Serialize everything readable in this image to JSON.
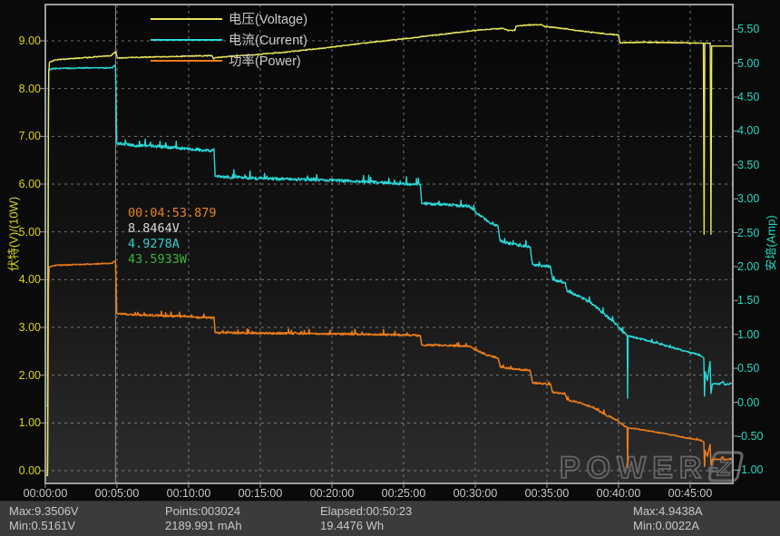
{
  "legend": [
    {
      "label": "电压(Voltage)",
      "color": "#e9e559"
    },
    {
      "label": "电流(Current)",
      "color": "#29d9d9"
    },
    {
      "label": "功率(Power)",
      "color": "#ea7c1c"
    }
  ],
  "axes": {
    "left": {
      "title": "伏特(V)/(10W)",
      "color": "#d6d41c",
      "ticks": [
        "9.00",
        "8.00",
        "7.00",
        "6.00",
        "5.00",
        "4.00",
        "3.00",
        "2.00",
        "1.00",
        "0.00"
      ]
    },
    "right": {
      "title": "安培(Amp)",
      "color": "#23d8c4",
      "ticks": [
        "5.50",
        "5.00",
        "4.50",
        "4.00",
        "3.50",
        "3.00",
        "2.50",
        "2.00",
        "1.50",
        "1.00",
        "0.50",
        "0.00",
        "-0.50",
        "-1.00"
      ]
    },
    "x": {
      "ticks": [
        "00:00:00",
        "00:05:00",
        "00:10:00",
        "00:15:00",
        "00:20:00",
        "00:25:00",
        "00:30:00",
        "00:35:00",
        "00:40:00",
        "00:45:00"
      ],
      "interval_s": 300
    }
  },
  "cursor": {
    "time_s": 293.879
  },
  "annotation": {
    "time": {
      "text": "00:04:53.879",
      "color": "#e8801e"
    },
    "voltage": {
      "text": "8.8464V",
      "color": "#d8d8d8"
    },
    "current": {
      "text": "4.9278A",
      "color": "#35cccc"
    },
    "power": {
      "text": "43.5933W",
      "color": "#3db53d"
    }
  },
  "status": {
    "max_voltage": "Max:9.3506V",
    "min_voltage": "Min:0.5161V",
    "points": "Points:003024",
    "capacity_mah": "2189.991 mAh",
    "elapsed": "Elapsed:00:50:23",
    "energy_wh": "19.4476 Wh",
    "max_current": "Max:4.9438A",
    "min_current": "Min:0.0022A"
  },
  "watermark": {
    "text": "POWER-",
    "z": "Z",
    "color": "#6e6e6e"
  },
  "chart_data": {
    "type": "line",
    "title": "",
    "x_unit": "seconds",
    "x_range_s": [
      0,
      2878
    ],
    "left_axis": {
      "label": "伏特(V)/(10W)",
      "range": [
        -0.27,
        9.76
      ]
    },
    "right_axis": {
      "label": "安培(Amp)",
      "range": [
        -1.21,
        5.86
      ]
    },
    "grid": true,
    "legend_position": "top-left",
    "series": [
      {
        "name": "功率(Power)",
        "unit": "W",
        "axis": "left",
        "scale": 0.1,
        "color": "#ea7c1c",
        "width": 1.5,
        "points": [
          [
            0,
            -0.5
          ],
          [
            9,
            -0.5
          ],
          [
            11,
            15
          ],
          [
            13,
            38
          ],
          [
            16,
            42.6
          ],
          [
            40,
            43.0
          ],
          [
            150,
            43.2
          ],
          [
            280,
            43.4
          ],
          [
            290,
            43.9
          ],
          [
            294,
            43.6
          ],
          [
            299,
            32.9
          ],
          [
            360,
            32.7
          ],
          [
            520,
            32.4
          ],
          [
            650,
            32.1
          ],
          [
            700,
            32.0
          ],
          [
            706,
            32.2
          ],
          [
            711,
            28.9
          ],
          [
            900,
            28.8
          ],
          [
            1150,
            28.7
          ],
          [
            1400,
            28.5
          ],
          [
            1500,
            28.4
          ],
          [
            1570,
            28.3
          ],
          [
            1576,
            26.3
          ],
          [
            1700,
            26.2
          ],
          [
            1780,
            26.0
          ],
          [
            1800,
            25.3
          ],
          [
            1850,
            24.2
          ],
          [
            1895,
            23.6
          ],
          [
            1905,
            21.7
          ],
          [
            1960,
            21.3
          ],
          [
            2030,
            21.0
          ],
          [
            2040,
            18.4
          ],
          [
            2115,
            18.1
          ],
          [
            2124,
            16.4
          ],
          [
            2176,
            16.1
          ],
          [
            2184,
            14.9
          ],
          [
            2240,
            14.2
          ],
          [
            2295,
            13.2
          ],
          [
            2343,
            11.8
          ],
          [
            2395,
            10.5
          ],
          [
            2420,
            9.6
          ],
          [
            2430,
            9.2
          ],
          [
            2436,
            9.1
          ],
          [
            2438,
            0.6
          ],
          [
            2440,
            9.0
          ],
          [
            2520,
            8.4
          ],
          [
            2620,
            7.5
          ],
          [
            2715,
            6.6
          ],
          [
            2752,
            6.2
          ],
          [
            2757,
            6.0
          ],
          [
            2760,
            0.9
          ],
          [
            2763,
            4.2
          ],
          [
            2772,
            3.0
          ],
          [
            2783,
            5.5
          ],
          [
            2787,
            1.2
          ],
          [
            2793,
            2.4
          ],
          [
            2825,
            2.4
          ],
          [
            2838,
            2.8
          ],
          [
            2843,
            2.3
          ],
          [
            2876,
            2.5
          ]
        ],
        "noise": [
          {
            "t0": 20,
            "t1": 285,
            "amp": 0.1,
            "spike": 0
          },
          {
            "t0": 305,
            "t1": 1565,
            "amp": 0.2,
            "spike": 0.9
          },
          {
            "t0": 1585,
            "t1": 2430,
            "amp": 0.18,
            "spike": 0.7
          },
          {
            "t0": 2445,
            "t1": 2745,
            "amp": 0.1,
            "spike": 0.4
          },
          {
            "t0": 2800,
            "t1": 2870,
            "amp": 0.08,
            "spike": 0.3
          }
        ]
      },
      {
        "name": "电流(Current)",
        "unit": "A",
        "axis": "right",
        "scale": 1,
        "color": "#29d9d9",
        "width": 1.4,
        "points": [
          [
            0,
            -0.05
          ],
          [
            9,
            -0.05
          ],
          [
            11,
            2.0
          ],
          [
            13,
            4.5
          ],
          [
            15,
            4.9
          ],
          [
            30,
            4.92
          ],
          [
            150,
            4.93
          ],
          [
            280,
            4.93
          ],
          [
            290,
            4.97
          ],
          [
            294,
            4.93
          ],
          [
            299,
            3.82
          ],
          [
            360,
            3.79
          ],
          [
            520,
            3.76
          ],
          [
            650,
            3.72
          ],
          [
            700,
            3.71
          ],
          [
            706,
            3.74
          ],
          [
            711,
            3.33
          ],
          [
            900,
            3.3
          ],
          [
            1150,
            3.28
          ],
          [
            1400,
            3.24
          ],
          [
            1500,
            3.22
          ],
          [
            1570,
            3.21
          ],
          [
            1576,
            2.93
          ],
          [
            1700,
            2.91
          ],
          [
            1780,
            2.88
          ],
          [
            1800,
            2.8
          ],
          [
            1850,
            2.67
          ],
          [
            1895,
            2.6
          ],
          [
            1905,
            2.37
          ],
          [
            1960,
            2.33
          ],
          [
            2030,
            2.29
          ],
          [
            2040,
            2.03
          ],
          [
            2115,
            2.0
          ],
          [
            2124,
            1.8
          ],
          [
            2176,
            1.77
          ],
          [
            2184,
            1.64
          ],
          [
            2240,
            1.56
          ],
          [
            2295,
            1.44
          ],
          [
            2343,
            1.29
          ],
          [
            2395,
            1.14
          ],
          [
            2420,
            1.03
          ],
          [
            2430,
            1.0
          ],
          [
            2436,
            0.99
          ],
          [
            2438,
            0.06
          ],
          [
            2440,
            0.98
          ],
          [
            2520,
            0.91
          ],
          [
            2620,
            0.81
          ],
          [
            2715,
            0.72
          ],
          [
            2752,
            0.67
          ],
          [
            2757,
            0.65
          ],
          [
            2760,
            0.09
          ],
          [
            2763,
            0.45
          ],
          [
            2772,
            0.32
          ],
          [
            2783,
            0.6
          ],
          [
            2787,
            0.13
          ],
          [
            2793,
            0.27
          ],
          [
            2825,
            0.27
          ],
          [
            2838,
            0.31
          ],
          [
            2843,
            0.26
          ],
          [
            2876,
            0.28
          ]
        ],
        "noise": [
          {
            "t0": 20,
            "t1": 285,
            "amp": 0.008,
            "spike": 0
          },
          {
            "t0": 305,
            "t1": 1565,
            "amp": 0.022,
            "spike": 0.1
          },
          {
            "t0": 1585,
            "t1": 2430,
            "amp": 0.02,
            "spike": 0.08
          },
          {
            "t0": 2445,
            "t1": 2745,
            "amp": 0.012,
            "spike": 0.05
          },
          {
            "t0": 2800,
            "t1": 2870,
            "amp": 0.01,
            "spike": 0.04
          }
        ]
      },
      {
        "name": "电压(Voltage)",
        "unit": "V",
        "axis": "left",
        "scale": 1,
        "color": "#e9e559",
        "width": 1.4,
        "points": [
          [
            0,
            -0.1
          ],
          [
            9,
            -0.1
          ],
          [
            10,
            0.52
          ],
          [
            12,
            6.5
          ],
          [
            14,
            8.3
          ],
          [
            17,
            8.55
          ],
          [
            40,
            8.6
          ],
          [
            120,
            8.63
          ],
          [
            200,
            8.66
          ],
          [
            275,
            8.69
          ],
          [
            285,
            8.74
          ],
          [
            296,
            8.77
          ],
          [
            301,
            8.64
          ],
          [
            360,
            8.65
          ],
          [
            520,
            8.67
          ],
          [
            698,
            8.69
          ],
          [
            704,
            8.62
          ],
          [
            712,
            8.65
          ],
          [
            850,
            8.7
          ],
          [
            1000,
            8.76
          ],
          [
            1150,
            8.84
          ],
          [
            1300,
            8.93
          ],
          [
            1420,
            9.0
          ],
          [
            1550,
            9.07
          ],
          [
            1700,
            9.16
          ],
          [
            1800,
            9.22
          ],
          [
            1850,
            9.24
          ],
          [
            1915,
            9.26
          ],
          [
            1938,
            9.22
          ],
          [
            1966,
            9.22
          ],
          [
            1971,
            9.31
          ],
          [
            2020,
            9.33
          ],
          [
            2075,
            9.34
          ],
          [
            2090,
            9.3
          ],
          [
            2150,
            9.27
          ],
          [
            2250,
            9.2
          ],
          [
            2340,
            9.15
          ],
          [
            2400,
            9.12
          ],
          [
            2406,
            8.96
          ],
          [
            2500,
            8.97
          ],
          [
            2650,
            8.96
          ],
          [
            2755,
            8.95
          ],
          [
            2758,
            4.95
          ],
          [
            2761,
            8.95
          ],
          [
            2784,
            8.95
          ],
          [
            2787,
            4.95
          ],
          [
            2790,
            8.89
          ],
          [
            2876,
            8.89
          ]
        ],
        "noise": [
          {
            "t0": 25,
            "t1": 2740,
            "amp": 0.01,
            "spike": 0
          }
        ]
      }
    ]
  }
}
